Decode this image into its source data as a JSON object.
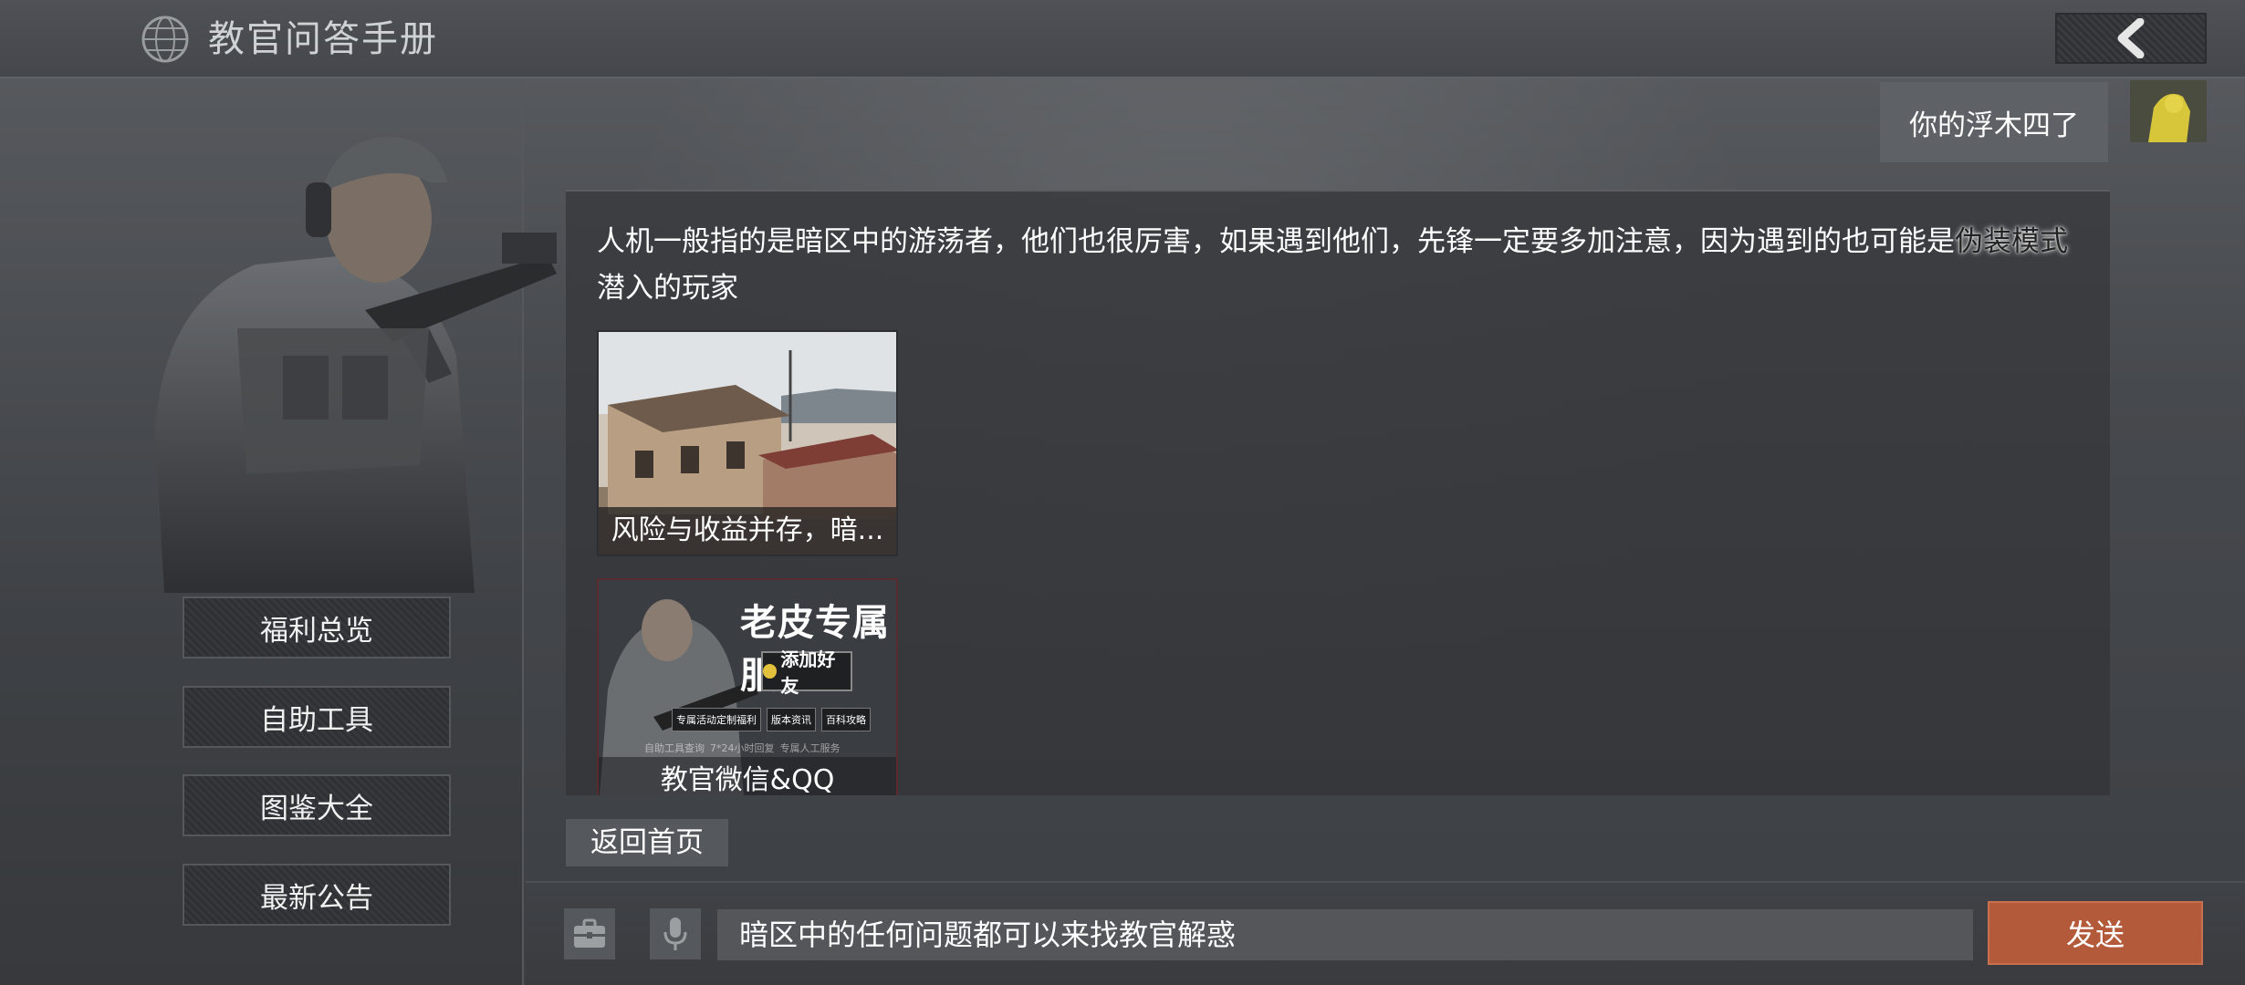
{
  "header": {
    "title": "教官问答手册",
    "logo_icon": "globe-logo-icon",
    "back_icon": "chevron-left-icon"
  },
  "sidebar": {
    "items": [
      {
        "label": "福利总览"
      },
      {
        "label": "自助工具"
      },
      {
        "label": "图鉴大全"
      },
      {
        "label": "最新公告"
      }
    ]
  },
  "user_message": {
    "text": "你的浮木四了"
  },
  "answer": {
    "text_main": "人机一般指的是暗区中的游荡者，他们也很厉害，如果遇到他们，先锋一定要多加注意，因为遇到的也可能是",
    "text_highlight": "伪装模式",
    "text_tail": "潜入的玩家",
    "cards": [
      {
        "caption": "风险与收益并存，暗..."
      },
      {
        "caption": "教官微信&QQ",
        "banner_title": "老皮专属服务",
        "banner_button": "添加好友",
        "banner_tags": [
          "专属活动定制福利",
          "版本资讯",
          "百科攻略"
        ],
        "banner_tags_row2": [
          "自助工具查询",
          "7*24小时回复",
          "专属人工服务"
        ]
      }
    ]
  },
  "home_button": {
    "label": "返回首页"
  },
  "composer": {
    "toolbox_icon": "toolbox-icon",
    "mic_icon": "microphone-icon",
    "input_value": "暗区中的任何问题都可以来找教官解惑",
    "send_label": "发送"
  },
  "colors": {
    "accent_send": "#b25a3a",
    "panel": "#3a3c3f"
  }
}
